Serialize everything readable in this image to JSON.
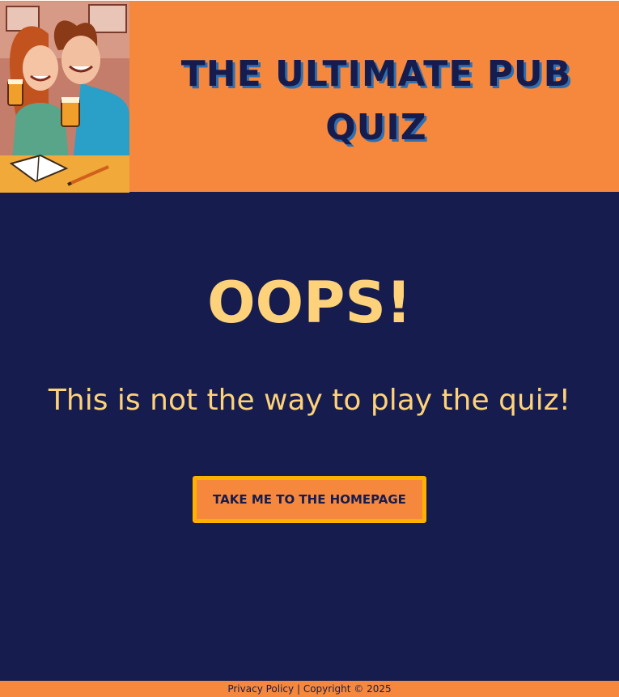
{
  "header": {
    "title": "THE ULTIMATE PUB QUIZ",
    "logo_alt_icon": "pub-couple-illustration"
  },
  "main": {
    "heading": "OOPS!",
    "message": "This is not the way to play the quiz!",
    "home_button_label": "TAKE ME TO THE HOMEPAGE"
  },
  "footer": {
    "privacy_link": "Privacy Policy",
    "separator": "|",
    "copyright": "Copyright © 2025"
  },
  "colors": {
    "header_bg": "#f6883d",
    "page_bg": "#161c4d",
    "accent_text": "#fdd27a",
    "button_border": "#ffb000"
  }
}
